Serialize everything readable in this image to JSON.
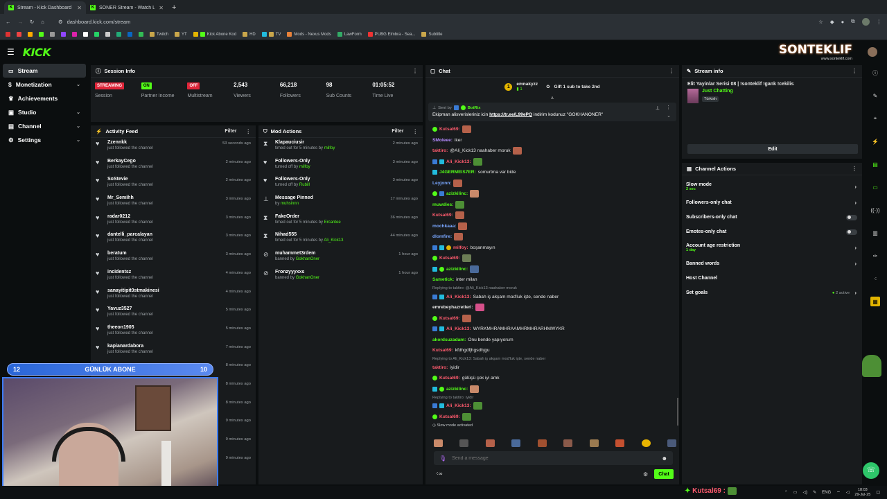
{
  "browser": {
    "tabs": [
      {
        "label": "Stream - Kick Dashboard",
        "active": true
      },
      {
        "label": "SONER Stream - Watch Live on",
        "active": false
      }
    ],
    "url": "dashboard.kick.com/stream",
    "bookmarks": [
      "Twitch",
      "YT",
      "Kick Abone Kod",
      "HD",
      "TV",
      "Mods - Nexus Mods",
      "LawForm",
      "PUBG Elmbra - Sea...",
      "Subtitle"
    ]
  },
  "overlay": {
    "brand": "SONTEKLIF",
    "brand_url": "www.sonteklif.com",
    "sub_label": "GÜNLÜK ABONE",
    "sub_left": "12",
    "sub_right": "10",
    "bottom_user": "Kutsal69 :"
  },
  "sidebar": {
    "items": [
      {
        "label": "Stream"
      },
      {
        "label": "Monetization"
      },
      {
        "label": "Achievements"
      },
      {
        "label": "Studio"
      },
      {
        "label": "Channel"
      },
      {
        "label": "Settings"
      }
    ]
  },
  "session": {
    "title": "Session Info",
    "stats": [
      {
        "value": "STREAMING",
        "label": "Session"
      },
      {
        "value": "ON",
        "label": "Partner Income"
      },
      {
        "value": "OFF",
        "label": "Multistream"
      },
      {
        "value": "2,543",
        "label": "Viewers"
      },
      {
        "value": "66,218",
        "label": "Followers"
      },
      {
        "value": "98",
        "label": "Sub Counts"
      },
      {
        "value": "01:05:52",
        "label": "Time Live"
      }
    ]
  },
  "activity": {
    "title": "Activity Feed",
    "filter": "Filter",
    "items": [
      {
        "name": "Zzennkk",
        "sub": "just followed the channel",
        "time": "53 seconds ago"
      },
      {
        "name": "BerkayCego",
        "sub": "just followed the channel",
        "time": "2 minutes ago"
      },
      {
        "name": "SoStevie",
        "sub": "just followed the channel",
        "time": "2 minutes ago"
      },
      {
        "name": "Mr_Semihh",
        "sub": "just followed the channel",
        "time": "3 minutes ago"
      },
      {
        "name": "radar0212",
        "sub": "just followed the channel",
        "time": "3 minutes ago"
      },
      {
        "name": "dantelli_parcalayan",
        "sub": "just followed the channel",
        "time": "3 minutes ago"
      },
      {
        "name": "beratum",
        "sub": "just followed the channel",
        "time": "3 minutes ago"
      },
      {
        "name": "incidentsz",
        "sub": "just followed the channel",
        "time": "4 minutes ago"
      },
      {
        "name": "sanayitipit0stmakinesi",
        "sub": "just followed the channel",
        "time": "4 minutes ago"
      },
      {
        "name": "Yavuz3527",
        "sub": "just followed the channel",
        "time": "5 minutes ago"
      },
      {
        "name": "theeon1905",
        "sub": "just followed the channel",
        "time": "5 minutes ago"
      },
      {
        "name": "kapianardabora",
        "sub": "just followed the channel",
        "time": "7 minutes ago"
      }
    ],
    "more_times": [
      "8 minutes ago",
      "8 minutes ago",
      "8 minutes ago",
      "9 minutes ago",
      "9 minutes ago",
      "9 minutes ago"
    ]
  },
  "mod": {
    "title": "Mod Actions",
    "filter": "Filter",
    "items": [
      {
        "name": "Klapauciusir",
        "pre": "timed out for 5 minutes by",
        "by": "milfoy",
        "time": "2 minutes ago",
        "icon": "hourglass-icon"
      },
      {
        "name": "Followers-Only",
        "pre": "turned off by",
        "by": "milfoy",
        "time": "3 minutes ago",
        "icon": "heart-icon"
      },
      {
        "name": "Followers-Only",
        "pre": "turned off by",
        "by": "Rubill",
        "time": "3 minutes ago",
        "icon": "heart-icon"
      },
      {
        "name": "Message Pinned",
        "pre": "by",
        "by": "muhsinnn",
        "time": "17 minutes ago",
        "icon": "pin-icon"
      },
      {
        "name": "FakeOrder",
        "pre": "timed out for 5 minutes by",
        "by": "Ercantee",
        "time": "36 minutes ago",
        "icon": "hourglass-icon"
      },
      {
        "name": "Nihad555",
        "pre": "timed out for 5 minutes by",
        "by": "Ali_Kick13",
        "time": "44 minutes ago",
        "icon": "hourglass-icon"
      },
      {
        "name": "muhammet3rdem",
        "pre": "banned by",
        "by": "GokhanOner",
        "time": "1 hour ago",
        "icon": "ban-icon"
      },
      {
        "name": "Fronzyyyxxs",
        "pre": "banned by",
        "by": "GokhanOner",
        "time": "1 hour ago",
        "icon": "ban-icon"
      }
    ]
  },
  "chat": {
    "title": "Chat",
    "gifter": "emnakyzz",
    "gifter_count": "1",
    "gift_text": "Gift 1 sub to take 2nd",
    "pinned_sender_prefix": "Sent by",
    "pinned_sender": "BotRix",
    "pinned_text_a": "Ekipman alisverisleriniz icin",
    "pinned_link": "https://tr.ee/L99ePQ",
    "pinned_text_b": "indirim kodunuz \"GOKHANONER\"",
    "messages": [
      {
        "user": "Kutsal69:",
        "color": "#ff5b6e",
        "text": "",
        "emote": "#b5614a"
      },
      {
        "user": "SMoleee:",
        "color": "#b58bff",
        "text": "iker",
        "emote": ""
      },
      {
        "user": "taktiro:",
        "color": "#ff5b6e",
        "text": "@Ali_Kick13 naahaber moruk",
        "emote": "#b5614a"
      },
      {
        "user": "Ali_Kick13:",
        "color": "#ff5b6e",
        "text": "",
        "emote": "#4d8f35"
      },
      {
        "user": "J4GERMEIS7ER:",
        "color": "#53fc18",
        "text": "somurtma var bide",
        "emote": ""
      },
      {
        "user": "Leyjonn:",
        "color": "#7aa7ff",
        "text": "",
        "emote": "#b5614a"
      },
      {
        "user": "azizkilinc:",
        "color": "#53fc18",
        "text": "",
        "emote": "#c98a6a"
      },
      {
        "user": "muwdies:",
        "color": "#53fc18",
        "text": "",
        "emote": "#4d8f35"
      },
      {
        "user": "Kutsal69:",
        "color": "#ff5b6e",
        "text": "",
        "emote": "#b5614a"
      },
      {
        "user": "mochkaaa:",
        "color": "#7aa7ff",
        "text": "",
        "emote": "#b5614a"
      },
      {
        "user": "dlomfire:",
        "color": "#7aa7ff",
        "text": "",
        "emote": "#b5614a"
      },
      {
        "user": "milfoy:",
        "color": "#ff5b6e",
        "text": "boşanmayın",
        "emote": ""
      },
      {
        "user": "Kutsal69:",
        "color": "#ff5b6e",
        "text": "",
        "emote": "#6b7d55"
      },
      {
        "user": "azizkilinc:",
        "color": "#53fc18",
        "text": "",
        "emote": "#4a6a9a"
      },
      {
        "user": "Sametick:",
        "color": "#53fc18",
        "text": "inter milan",
        "emote": ""
      }
    ],
    "reply1": "Replying to taktiro: @Ali_Kick13 naahaber moruk",
    "messages2": [
      {
        "user": "Ali_Kick13:",
        "color": "#ff5b6e",
        "text": "Sabah iş akşam mod'luk işte, sende naber",
        "emote": ""
      },
      {
        "user": "emrebeyhazretleri:",
        "color": "#e6e6e6",
        "text": "",
        "emote": "#d6508a"
      },
      {
        "user": "Kutsal69:",
        "color": "#ff5b6e",
        "text": "",
        "emote": "#b5614a"
      },
      {
        "user": "Ali_Kick13:",
        "color": "#ff5b6e",
        "text": "WYRKMHRAMHRAAMHRMHRARHMWYKR",
        "emote": ""
      },
      {
        "user": "akordsuzadam:",
        "color": "#53fc18",
        "text": "Onu bende yapıyorum",
        "emote": ""
      },
      {
        "user": "Kutsal69:",
        "color": "#ff5b6e",
        "text": "kfdhgdfjhgsdhjgu",
        "emote": ""
      }
    ],
    "reply2": "Replying to Ali_Kick13: Sabah iş akşam mod'luk işte, sende naber",
    "messages3": [
      {
        "user": "taktiro:",
        "color": "#ff5b6e",
        "text": "iyidir",
        "emote": ""
      },
      {
        "user": "Kutsal69:",
        "color": "#ff5b6e",
        "text": "gülüşü çok iyi amk",
        "emote": ""
      },
      {
        "user": "azizkilinc:",
        "color": "#53fc18",
        "text": "",
        "emote": "#c98a6a"
      }
    ],
    "reply3": "Replying to taktiro: iyidir",
    "messages4": [
      {
        "user": "Ali_Kick13:",
        "color": "#ff5b6e",
        "text": "",
        "emote": "#4d8f35"
      },
      {
        "user": "Kutsal69:",
        "color": "#ff5b6e",
        "text": "",
        "emote": "#4d8f35"
      }
    ],
    "slow_mode": "Slow mode activated",
    "input_placeholder": "Send a message",
    "send_label": "Chat"
  },
  "stream_info": {
    "title": "Stream info",
    "stream_title": "Elit Yayinlar Serisi 08 | !sonteklif !gank !cekilis",
    "category": "Just Chatting",
    "language": "Türkish",
    "edit_label": "Edit"
  },
  "channel_actions": {
    "title": "Channel Actions",
    "items": [
      {
        "label": "Slow mode",
        "sub": "2 sec",
        "control": "arrow"
      },
      {
        "label": "Followers-only chat",
        "sub": "",
        "control": "arrow"
      },
      {
        "label": "Subscribers-only chat",
        "sub": "",
        "control": "toggle"
      },
      {
        "label": "Emotes-only chat",
        "sub": "",
        "control": "toggle"
      },
      {
        "label": "Account age restriction",
        "sub": "1 day",
        "control": "arrow"
      },
      {
        "label": "Banned words",
        "sub": "",
        "control": "arrow"
      },
      {
        "label": "Host Channel",
        "sub": "",
        "control": "none"
      },
      {
        "label": "Set goals",
        "sub": "",
        "control": "arrow",
        "extra": "2 active"
      }
    ]
  },
  "taskbar": {
    "lang": "ENG",
    "time": "18:03",
    "date": "29-Jul-25"
  },
  "colors": {
    "accent": "#53fc18",
    "panel": "#181b1d",
    "bg": "#0b0e0f"
  }
}
